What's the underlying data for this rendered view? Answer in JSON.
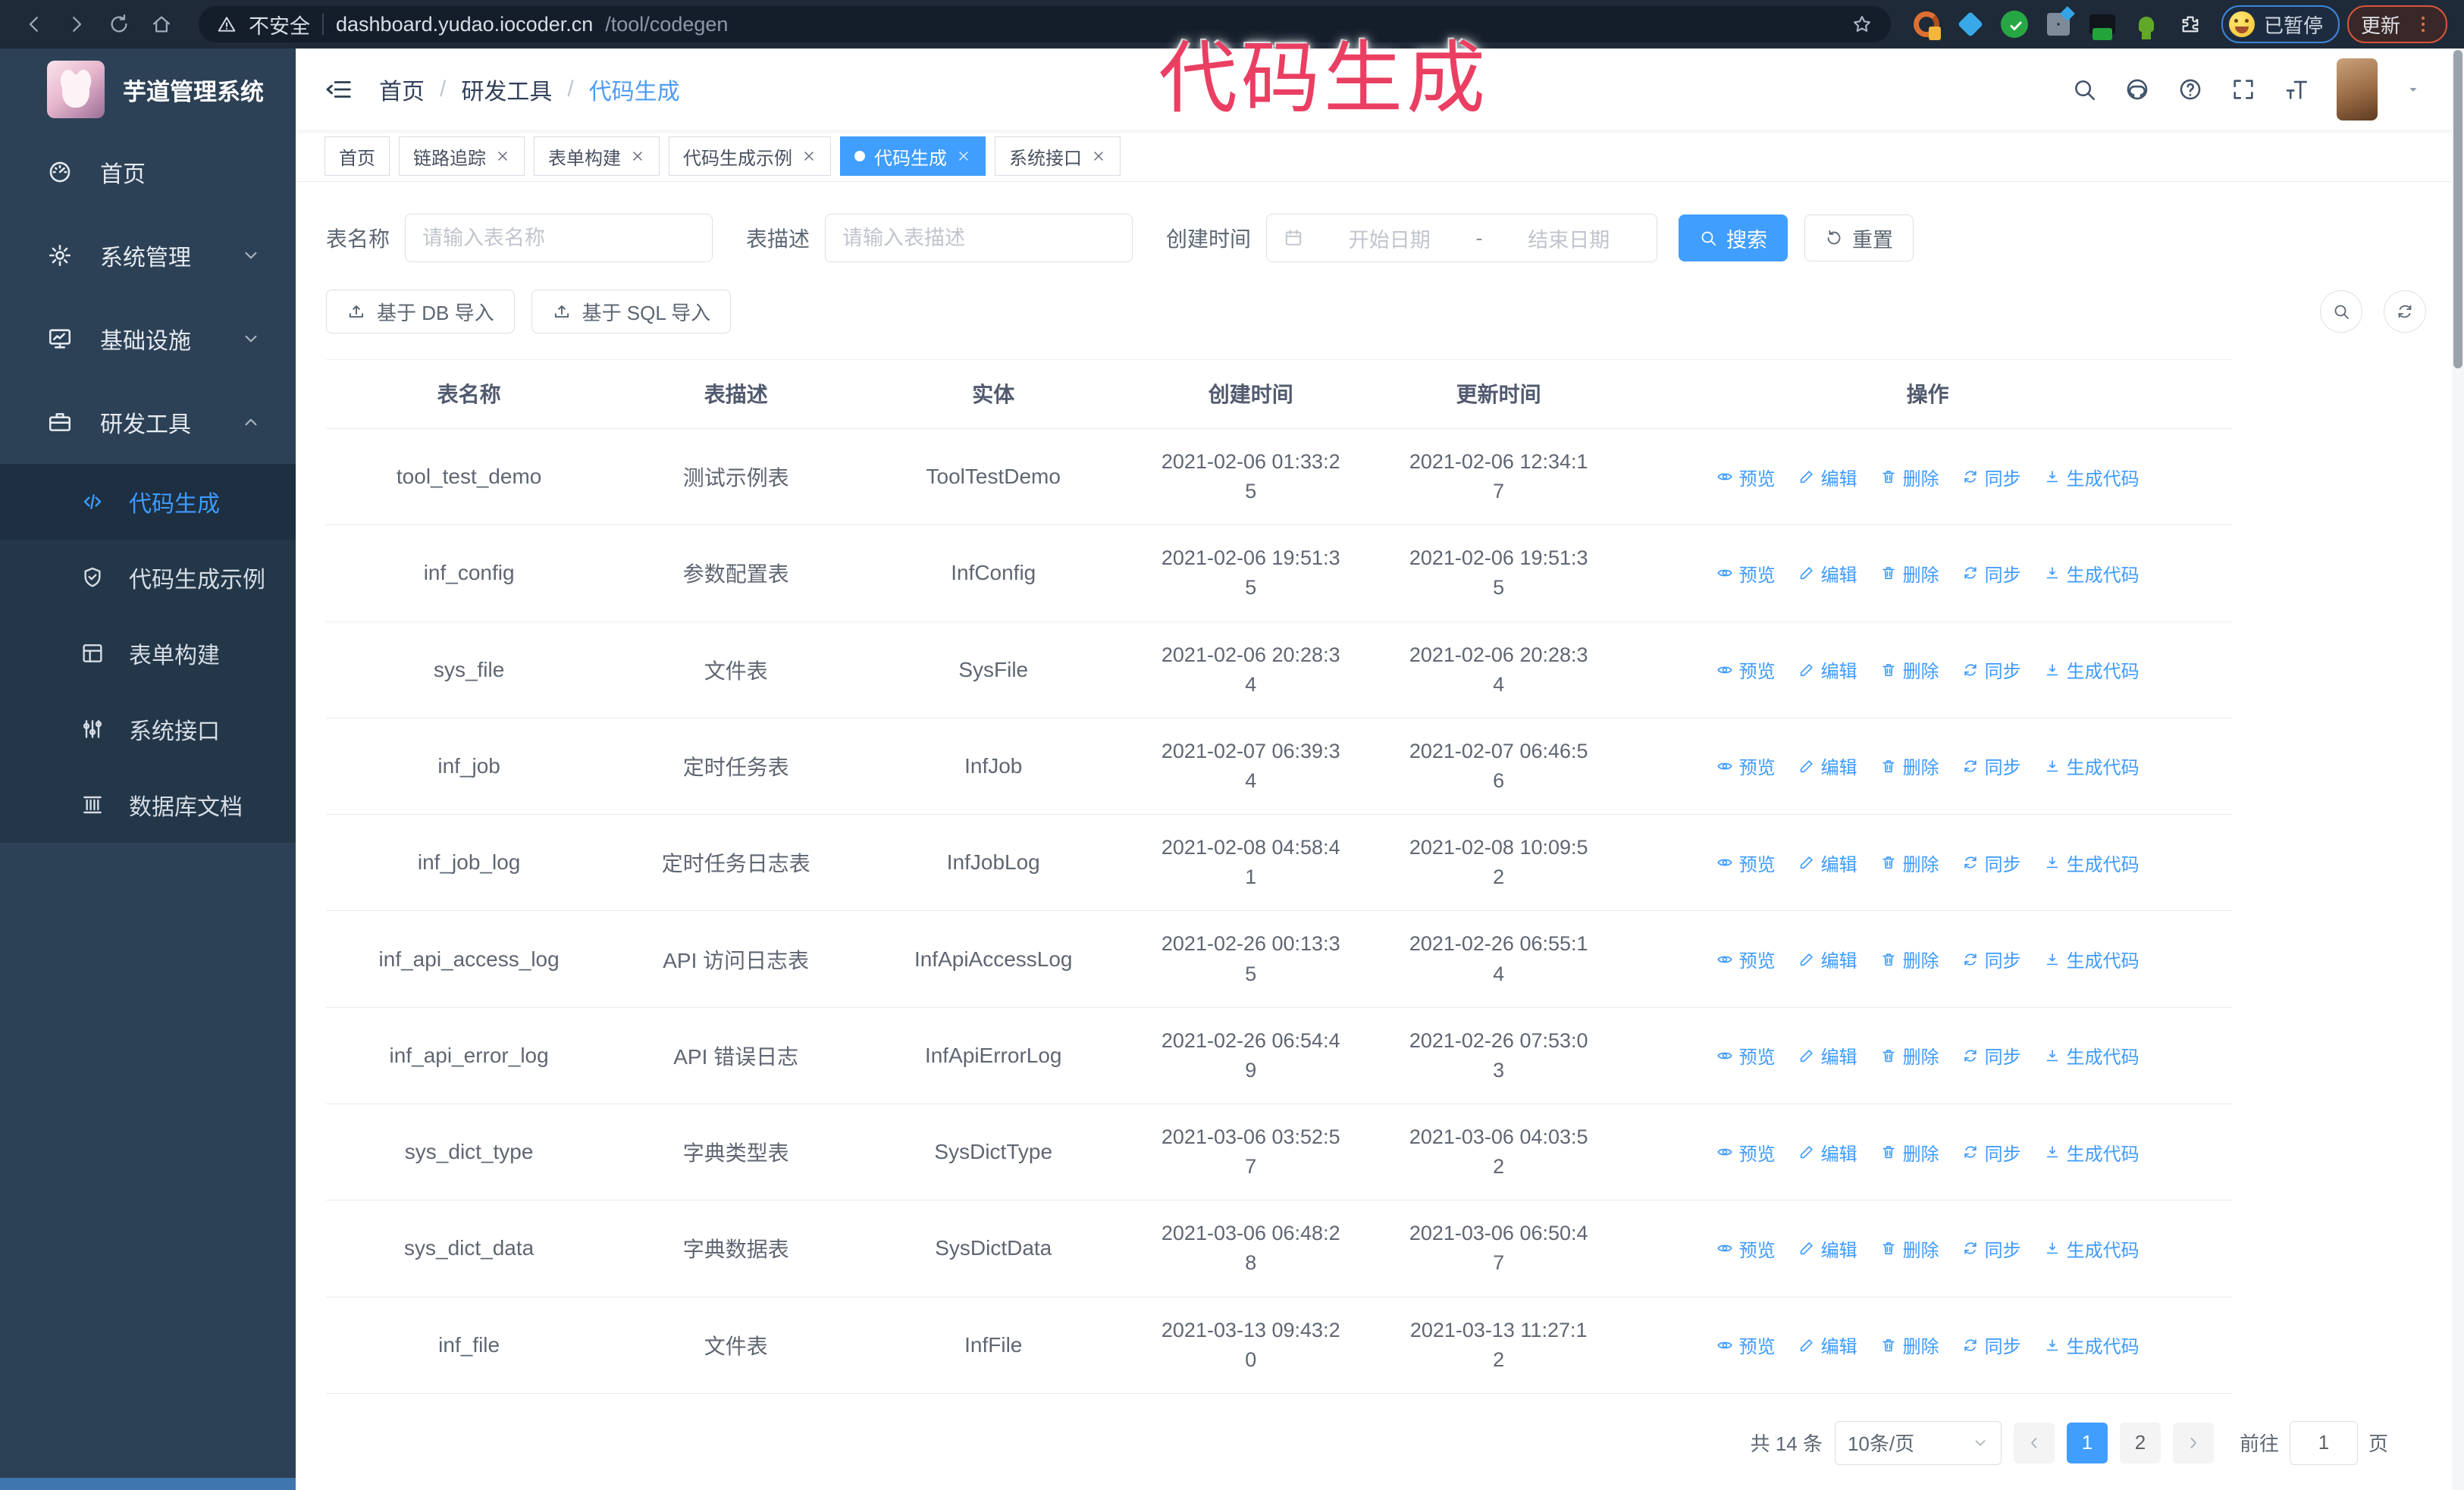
{
  "browser": {
    "security_label": "不安全",
    "url_host": "dashboard.yudao.iocoder.cn",
    "url_path": "/tool/codegen",
    "paused_badge": "已暂停",
    "update_badge": "更新",
    "icons": [
      "back-icon",
      "forward-icon",
      "reload-icon",
      "home-icon",
      "warning-icon",
      "star-icon",
      "extensions-puzzle-icon",
      "overflow-menu-icon"
    ]
  },
  "annotation": {
    "text": "代码生成",
    "color": "#ea3f62"
  },
  "sidebar": {
    "app_title": "芋道管理系统",
    "items": [
      {
        "label": "首页",
        "icon": "dashboard-icon",
        "chevron": ""
      },
      {
        "label": "系统管理",
        "icon": "gear-icon",
        "chevron": "down"
      },
      {
        "label": "基础设施",
        "icon": "infrastructure-icon",
        "chevron": "down"
      },
      {
        "label": "研发工具",
        "icon": "dev-tools-icon",
        "chevron": "up",
        "expanded": true
      }
    ],
    "subitems": [
      {
        "label": "代码生成",
        "icon": "code-icon",
        "active": true
      },
      {
        "label": "代码生成示例",
        "icon": "example-shield-icon",
        "active": false
      },
      {
        "label": "表单构建",
        "icon": "form-builder-icon",
        "active": false
      },
      {
        "label": "系统接口",
        "icon": "api-sliders-icon",
        "active": false
      },
      {
        "label": "数据库文档",
        "icon": "database-doc-icon",
        "active": false
      }
    ]
  },
  "breadcrumb": {
    "separator": "/",
    "items": [
      "首页",
      "研发工具",
      "代码生成"
    ]
  },
  "tabs": [
    {
      "label": "首页",
      "closable": false,
      "active": false
    },
    {
      "label": "链路追踪",
      "closable": true,
      "active": false
    },
    {
      "label": "表单构建",
      "closable": true,
      "active": false
    },
    {
      "label": "代码生成示例",
      "closable": true,
      "active": false
    },
    {
      "label": "代码生成",
      "closable": true,
      "active": true
    },
    {
      "label": "系统接口",
      "closable": true,
      "active": false
    }
  ],
  "filters": {
    "table_name_label": "表名称",
    "table_name_placeholder": "请输入表名称",
    "table_desc_label": "表描述",
    "table_desc_placeholder": "请输入表描述",
    "create_time_label": "创建时间",
    "date_start_placeholder": "开始日期",
    "date_separator": "-",
    "date_end_placeholder": "结束日期",
    "search_label": "搜索",
    "reset_label": "重置"
  },
  "toolbar": {
    "import_db_label": "基于 DB 导入",
    "import_sql_label": "基于 SQL 导入",
    "mini_buttons": [
      "search-icon",
      "refresh-icon"
    ]
  },
  "table": {
    "columns": [
      "表名称",
      "表描述",
      "实体",
      "创建时间",
      "更新时间",
      "操作"
    ],
    "action_labels": [
      "预览",
      "编辑",
      "删除",
      "同步",
      "生成代码"
    ],
    "action_icons": [
      "eye-icon",
      "pencil-icon",
      "trash-icon",
      "sync-icon",
      "download-icon"
    ],
    "rows": [
      {
        "name": "tool_test_demo",
        "desc": "测试示例表",
        "entity": "ToolTestDemo",
        "created": "2021-02-06 01:33:25",
        "updated": "2021-02-06 12:34:17"
      },
      {
        "name": "inf_config",
        "desc": "参数配置表",
        "entity": "InfConfig",
        "created": "2021-02-06 19:51:35",
        "updated": "2021-02-06 19:51:35"
      },
      {
        "name": "sys_file",
        "desc": "文件表",
        "entity": "SysFile",
        "created": "2021-02-06 20:28:34",
        "updated": "2021-02-06 20:28:34"
      },
      {
        "name": "inf_job",
        "desc": "定时任务表",
        "entity": "InfJob",
        "created": "2021-02-07 06:39:34",
        "updated": "2021-02-07 06:46:56"
      },
      {
        "name": "inf_job_log",
        "desc": "定时任务日志表",
        "entity": "InfJobLog",
        "created": "2021-02-08 04:58:41",
        "updated": "2021-02-08 10:09:52"
      },
      {
        "name": "inf_api_access_log",
        "desc": "API 访问日志表",
        "entity": "InfApiAccessLog",
        "created": "2021-02-26 00:13:35",
        "updated": "2021-02-26 06:55:14"
      },
      {
        "name": "inf_api_error_log",
        "desc": "API 错误日志",
        "entity": "InfApiErrorLog",
        "created": "2021-02-26 06:54:49",
        "updated": "2021-02-26 07:53:03"
      },
      {
        "name": "sys_dict_type",
        "desc": "字典类型表",
        "entity": "SysDictType",
        "created": "2021-03-06 03:52:57",
        "updated": "2021-03-06 04:03:52"
      },
      {
        "name": "sys_dict_data",
        "desc": "字典数据表",
        "entity": "SysDictData",
        "created": "2021-03-06 06:48:28",
        "updated": "2021-03-06 06:50:47"
      },
      {
        "name": "inf_file",
        "desc": "文件表",
        "entity": "InfFile",
        "created": "2021-03-13 09:43:20",
        "updated": "2021-03-13 11:27:12"
      }
    ]
  },
  "pagination": {
    "total_label": "共 14 条",
    "page_size_label": "10条/页",
    "pages": [
      "1",
      "2"
    ],
    "active_page": "1",
    "goto_label": "前往",
    "goto_value": "1",
    "unit_label": "页"
  },
  "colors": {
    "primary": "#409eff",
    "link": "#3e9bff",
    "annotation": "#ea3f62",
    "sidebar_bg": "#2d4156",
    "submenu_bg": "#233749",
    "chrome_bg": "#1e2a38"
  }
}
